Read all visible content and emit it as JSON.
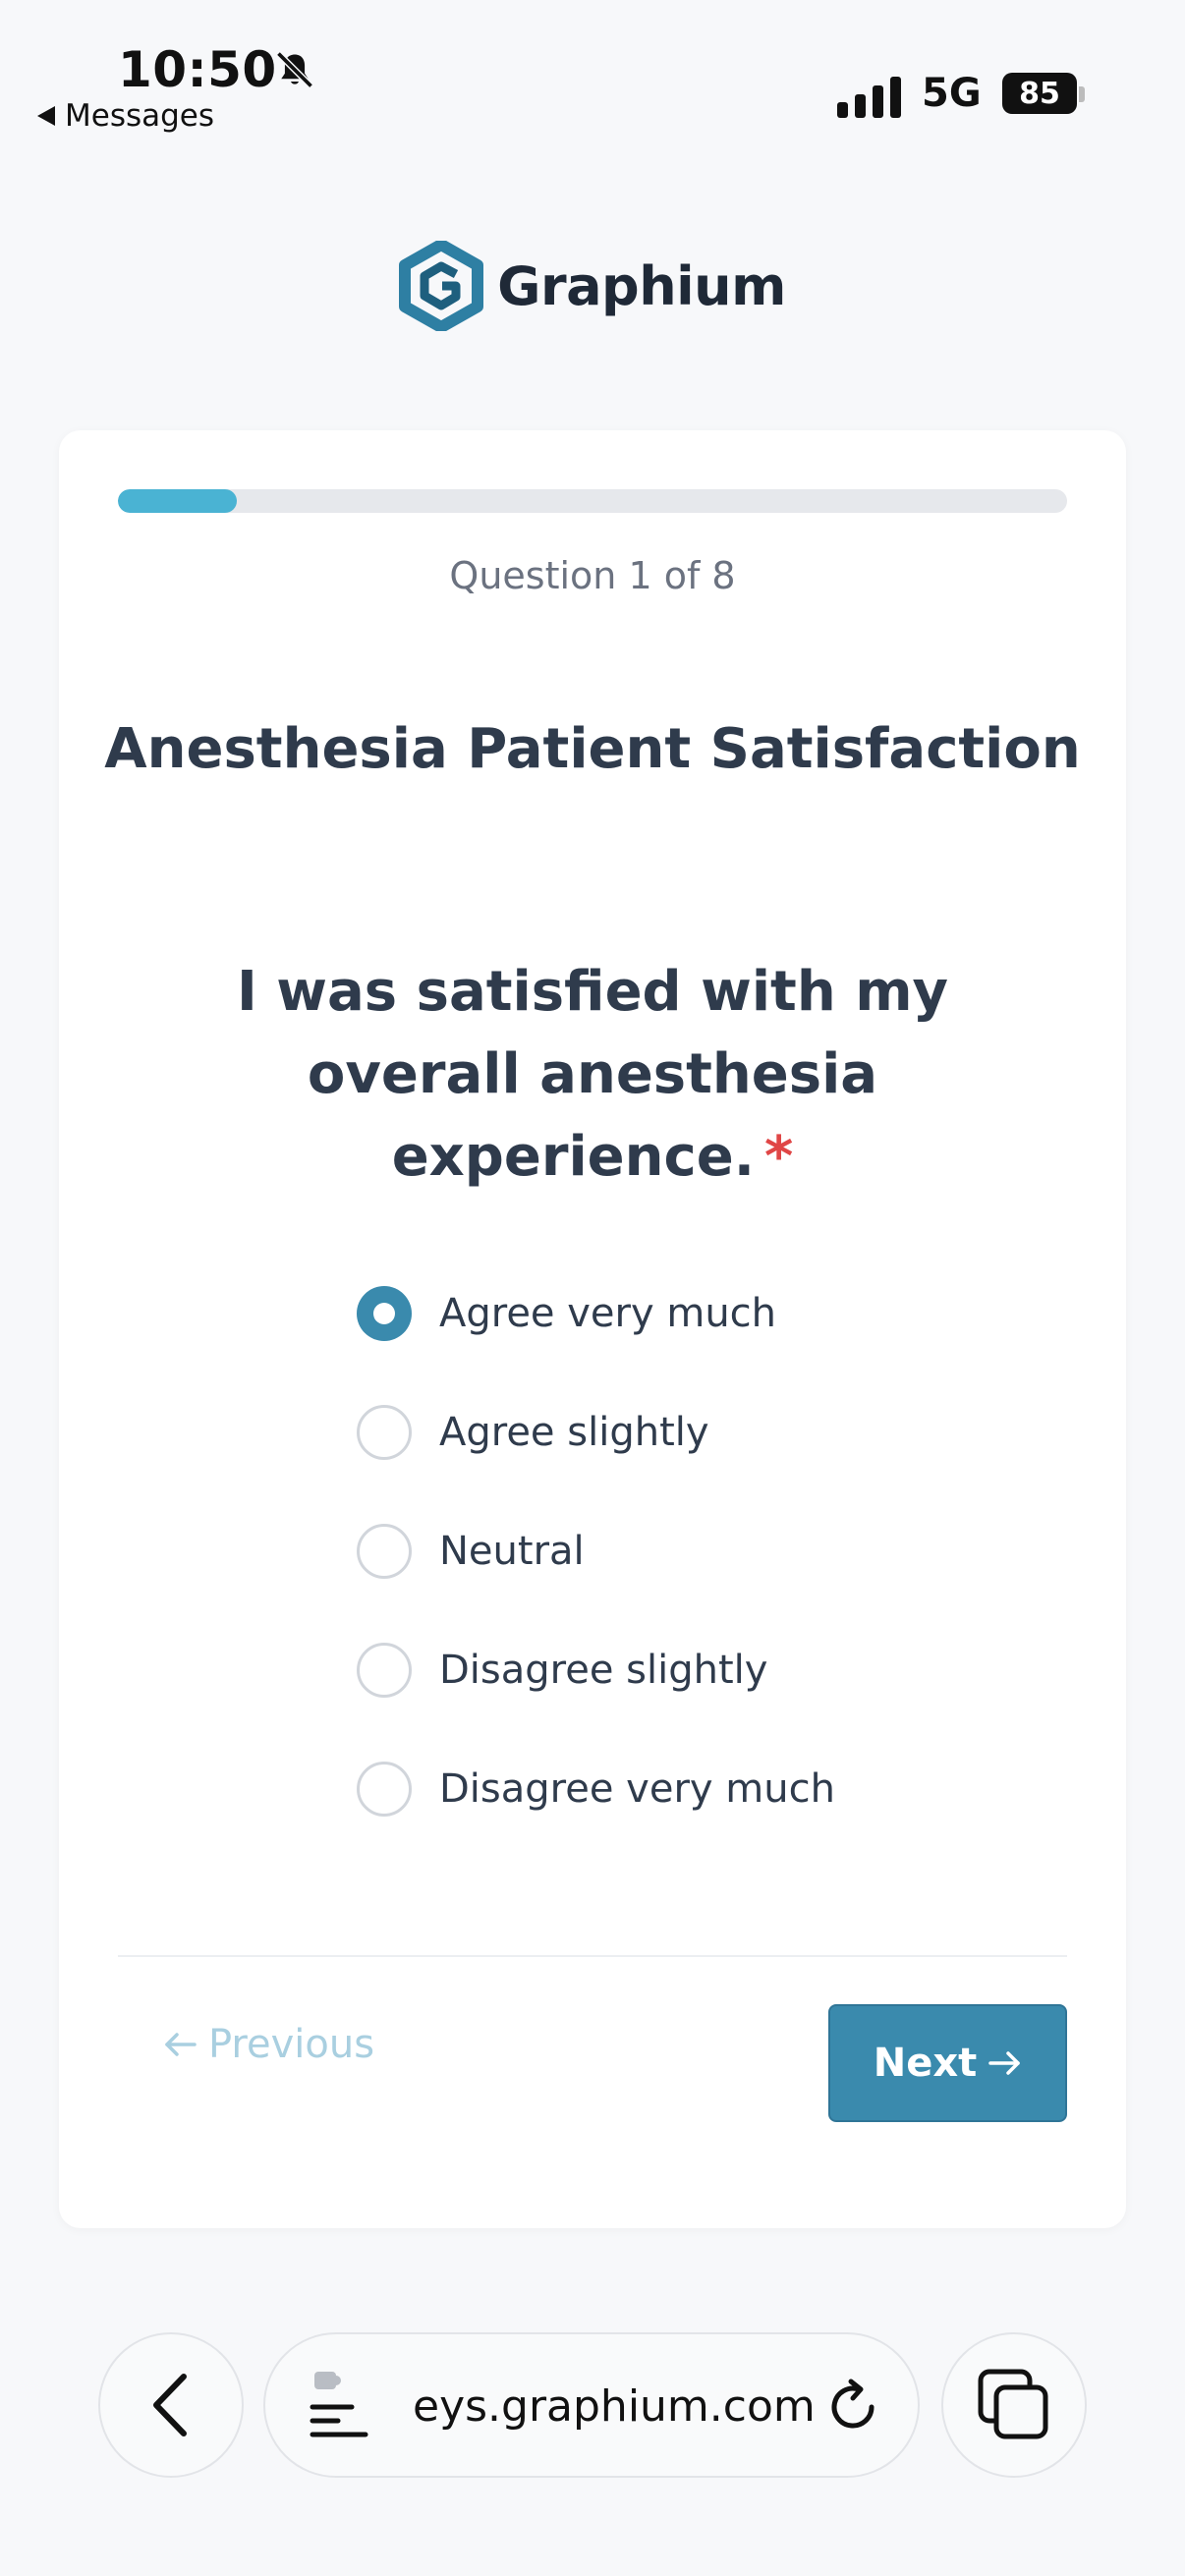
{
  "status_bar": {
    "time": "10:50",
    "back_app_label": "Messages",
    "network": "5G",
    "battery_level": "85"
  },
  "logo": {
    "text": "Graphium",
    "color": "#2e7fa3"
  },
  "survey": {
    "progress_fraction": 0.125,
    "question_count": "Question 1 of 8",
    "title": "Anesthesia Patient Satisfaction",
    "question": "I was satisfied with my overall anesthesia experience.",
    "required_marker": "*",
    "options": [
      {
        "label": "Agree very much",
        "selected": true
      },
      {
        "label": "Agree slightly",
        "selected": false
      },
      {
        "label": "Neutral",
        "selected": false
      },
      {
        "label": "Disagree slightly",
        "selected": false
      },
      {
        "label": "Disagree very much",
        "selected": false
      }
    ],
    "previous_label": "Previous",
    "next_label": "Next"
  },
  "browser": {
    "url": "eys.graphium.com"
  },
  "colors": {
    "accent": "#3a8aad",
    "progress": "#4ab3d3",
    "required": "#e04646"
  },
  "icons": {
    "bell": "bell-slash-icon",
    "signal": "cellular-signal-icon",
    "back": "chevron-left-icon",
    "addr": "reader-mode-icon",
    "reload": "reload-icon",
    "tabs": "tabs-icon"
  }
}
